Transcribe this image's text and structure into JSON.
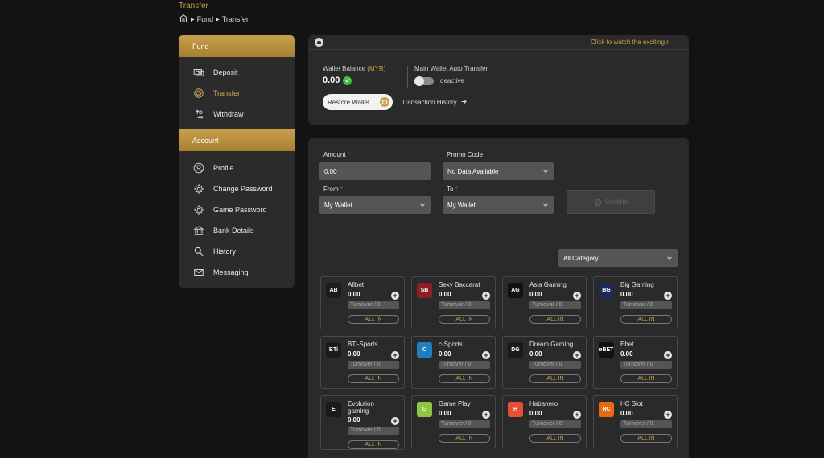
{
  "header": {
    "title": "Transfer",
    "breadcrumb": [
      "Fund",
      "Transfer"
    ]
  },
  "sidebar": {
    "fund_heading": "Fund",
    "fund_items": [
      {
        "label": "Deposit",
        "icon": "cash-icon"
      },
      {
        "label": "Transfer",
        "icon": "transfer-coin-icon"
      },
      {
        "label": "Withdraw",
        "icon": "withdraw-icon"
      }
    ],
    "account_heading": "Account",
    "account_items": [
      {
        "label": "Profile",
        "icon": "user-icon"
      },
      {
        "label": "Change Password",
        "icon": "gear-icon"
      },
      {
        "label": "Game Password",
        "icon": "gear-icon"
      },
      {
        "label": "Bank Details",
        "icon": "bank-icon"
      },
      {
        "label": "History",
        "icon": "search-icon"
      },
      {
        "label": "Messaging",
        "icon": "mail-icon"
      }
    ]
  },
  "announcement": {
    "text": "Click to watch the exciting r"
  },
  "wallet": {
    "balance_label": "Wallet Balance",
    "currency": "(MYR)",
    "balance": "0.00",
    "auto_transfer_label": "Main Wallet Auto Transfer",
    "auto_transfer_state": "deactive",
    "restore_label": "Restore Wallet",
    "history_label": "Transaction History"
  },
  "form": {
    "amount_label": "Amount",
    "amount_value": "0.00",
    "promo_label": "Promo Code",
    "promo_value": "No Data Available",
    "from_label": "From",
    "from_value": "My Wallet",
    "to_label": "To",
    "to_value": "My Wallet",
    "confirm_label": "Confirm",
    "required_mark": "*"
  },
  "category": {
    "selected": "All Category"
  },
  "games": [
    {
      "name": "Allbet",
      "amount": "0.00",
      "turnover": "Turnover / 0",
      "allin": "ALL IN",
      "logo_bg": "#1c1c1c",
      "logo_text": "AB"
    },
    {
      "name": "Sexy Baccarat",
      "amount": "0.00",
      "turnover": "Turnover / 0",
      "allin": "ALL IN",
      "logo_bg": "#8a1f2a",
      "logo_text": "SB"
    },
    {
      "name": "Asia Gaming",
      "amount": "0.00",
      "turnover": "Turnover / 0",
      "allin": "ALL IN",
      "logo_bg": "#111111",
      "logo_text": "AG"
    },
    {
      "name": "Big Gaming",
      "amount": "0.00",
      "turnover": "Turnover / 0",
      "allin": "ALL IN",
      "logo_bg": "#1d2a55",
      "logo_text": "BG"
    },
    {
      "name": "BTi-Sports",
      "amount": "0.00",
      "turnover": "Turnover / 0",
      "allin": "ALL IN",
      "logo_bg": "#1a1a1a",
      "logo_text": "BTi"
    },
    {
      "name": "c-Sports",
      "amount": "0.00",
      "turnover": "Turnover / 0",
      "allin": "ALL IN",
      "logo_bg": "#1f7fbf",
      "logo_text": "C"
    },
    {
      "name": "Dream Gaming",
      "amount": "0.00",
      "turnover": "Turnover / 0",
      "allin": "ALL IN",
      "logo_bg": "#1a1a1a",
      "logo_text": "DG"
    },
    {
      "name": "Ebet",
      "amount": "0.00",
      "turnover": "Turnover / 0",
      "allin": "ALL IN",
      "logo_bg": "#111111",
      "logo_text": "eBET"
    },
    {
      "name": "Evolution gaming",
      "amount": "0.00",
      "turnover": "Turnover / 0",
      "allin": "ALL IN",
      "logo_bg": "#1a1a1a",
      "logo_text": "E"
    },
    {
      "name": "Game Play",
      "amount": "0.00",
      "turnover": "Turnover / 0",
      "allin": "ALL IN",
      "logo_bg": "#8fc53f",
      "logo_text": "G"
    },
    {
      "name": "Habanero",
      "amount": "0.00",
      "turnover": "Turnover / 0",
      "allin": "ALL IN",
      "logo_bg": "#e94f36",
      "logo_text": "H"
    },
    {
      "name": "HC Slot",
      "amount": "0.00",
      "turnover": "Turnover / 0",
      "allin": "ALL IN",
      "logo_bg": "#e76b13",
      "logo_text": "HC"
    }
  ],
  "colors": {
    "accent": "#c9a24a",
    "panel": "#2a2a2a",
    "background": "#131313"
  }
}
